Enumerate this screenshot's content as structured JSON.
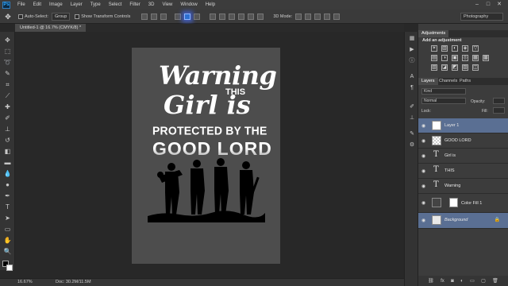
{
  "app": {
    "logo": "Ps",
    "menu": [
      "File",
      "Edit",
      "Image",
      "Layer",
      "Type",
      "Select",
      "Filter",
      "3D",
      "View",
      "Window",
      "Help"
    ],
    "window_controls": [
      "–",
      "□",
      "✕"
    ]
  },
  "options_bar": {
    "auto_select_label": "Auto-Select:",
    "auto_select_target": "Group",
    "show_transform_label": "Show Transform Controls",
    "mode_3d_label": "3D Mode:",
    "workspace": "Photography"
  },
  "document": {
    "tab_title": "Untitled-1 @ 16.7% (CMYK/8) *",
    "zoom": "16.67%",
    "doc_size": "Doc: 30.2M/11.5M"
  },
  "artwork": {
    "line1": "Warning",
    "line2": "THIS",
    "line3": "Girl is",
    "line4": "PROTECTED BY THE",
    "line5": "GOOD LORD"
  },
  "adjustments": {
    "tab": "Adjustments",
    "title": "Add an adjustment",
    "icons_row1": [
      "☀",
      "▥",
      "◐",
      "◈",
      "▽"
    ],
    "icons_row2": [
      "▤",
      "◑",
      "▣",
      "◎",
      "▦",
      "▩"
    ],
    "icons_row3": [
      "▧",
      "◪",
      "◩",
      "▨",
      "◫"
    ]
  },
  "layers_panel": {
    "tabs": [
      "Layers",
      "Channels",
      "Paths"
    ],
    "kind_filter": "Kind",
    "blend_mode": "Normal",
    "opacity_label": "Opacity:",
    "lock_label": "Lock:",
    "fill_label": "Fill:",
    "layers": [
      {
        "name": "Layer 1",
        "kind": "pixel",
        "selected": true
      },
      {
        "name": "GOOD LORD",
        "kind": "pixel",
        "selected": false
      },
      {
        "name": "Girl is",
        "kind": "type",
        "selected": false
      },
      {
        "name": "THIS",
        "kind": "type",
        "selected": false
      },
      {
        "name": "Warning",
        "kind": "type",
        "selected": false
      },
      {
        "name": "Color Fill 1",
        "kind": "fill",
        "selected": false
      },
      {
        "name": "Background",
        "kind": "background",
        "selected": true
      }
    ],
    "footer_icons": [
      "⛓",
      "fx",
      "◙",
      "◐",
      "▭",
      "▢",
      "🗑"
    ]
  }
}
